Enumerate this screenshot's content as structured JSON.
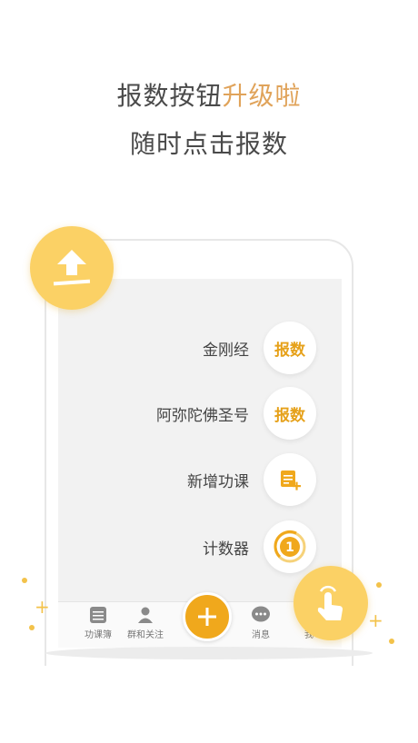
{
  "headline": {
    "line1_prefix": "报数按钮",
    "line1_accent": "升级啦",
    "line2": "随时点击报数"
  },
  "menu": [
    {
      "label": "金刚经",
      "button": "报数"
    },
    {
      "label": "阿弥陀佛圣号",
      "button": "报数"
    },
    {
      "label": "新增功课",
      "button_icon": "add-note-icon"
    },
    {
      "label": "计数器",
      "button_icon": "counter-icon",
      "counter_value": "1"
    }
  ],
  "tabbar": {
    "tabs": [
      {
        "label": "功课簿",
        "icon": "notebook-icon"
      },
      {
        "label": "群和关注",
        "icon": "user-icon"
      },
      {
        "label": "消息",
        "icon": "chat-icon"
      },
      {
        "label": "我",
        "icon": "profile-icon"
      }
    ]
  },
  "colors": {
    "accent": "#e0a35a",
    "button_yellow": "#f0a81c",
    "circle_yellow": "#fbd165"
  }
}
